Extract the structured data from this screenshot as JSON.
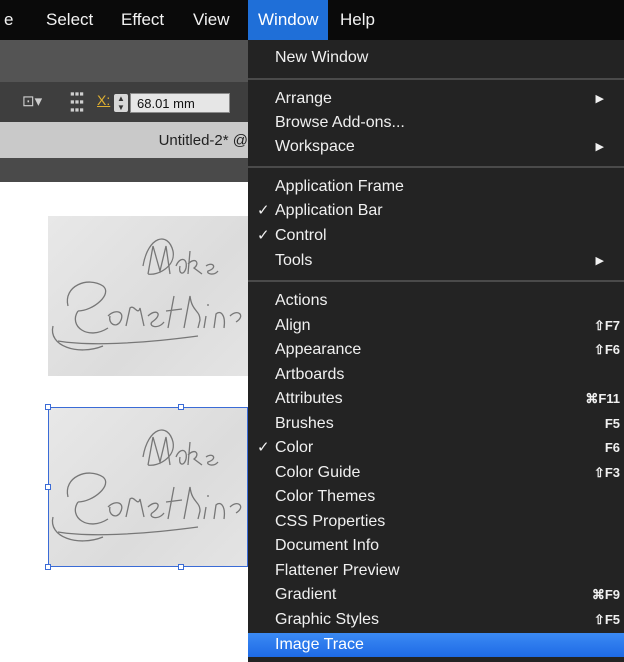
{
  "menubar": {
    "items": [
      "e",
      "Select",
      "Effect",
      "View",
      "Window",
      "Help"
    ],
    "active": "Window"
  },
  "control_bar": {
    "x_label": "X:",
    "x_value": "68.01 mm"
  },
  "document_tab": {
    "title": "Untitled-2* @"
  },
  "window_menu": {
    "items": [
      {
        "label": "New Window"
      },
      {
        "label": "Arrange",
        "submenu": true
      },
      {
        "label": "Browse Add-ons..."
      },
      {
        "label": "Workspace",
        "submenu": true
      },
      {
        "label": "Application Frame"
      },
      {
        "label": "Application Bar",
        "checked": true
      },
      {
        "label": "Control",
        "checked": true
      },
      {
        "label": "Tools",
        "submenu": true
      },
      {
        "label": "Actions"
      },
      {
        "label": "Align",
        "shortcut": "⇧F7"
      },
      {
        "label": "Appearance",
        "shortcut": "⇧F6"
      },
      {
        "label": "Artboards"
      },
      {
        "label": "Attributes",
        "shortcut": "⌘F11"
      },
      {
        "label": "Brushes",
        "shortcut": "F5"
      },
      {
        "label": "Color",
        "checked": true,
        "shortcut": "F6"
      },
      {
        "label": "Color Guide",
        "shortcut": "⇧F3"
      },
      {
        "label": "Color Themes"
      },
      {
        "label": "CSS Properties"
      },
      {
        "label": "Document Info"
      },
      {
        "label": "Flattener Preview"
      },
      {
        "label": "Gradient",
        "shortcut": "⌘F9"
      },
      {
        "label": "Graphic Styles",
        "shortcut": "⇧F5"
      },
      {
        "label": "Image Trace",
        "highlighted": true
      }
    ]
  },
  "icons": {
    "checkmark": "check-icon",
    "submenu_arrow": "triangle-right-icon"
  },
  "colors": {
    "menu_bg": "#232323",
    "menubar_bg": "#0a0a0a",
    "highlight": "#1f6fd8",
    "selection": "#3a6bd6"
  }
}
